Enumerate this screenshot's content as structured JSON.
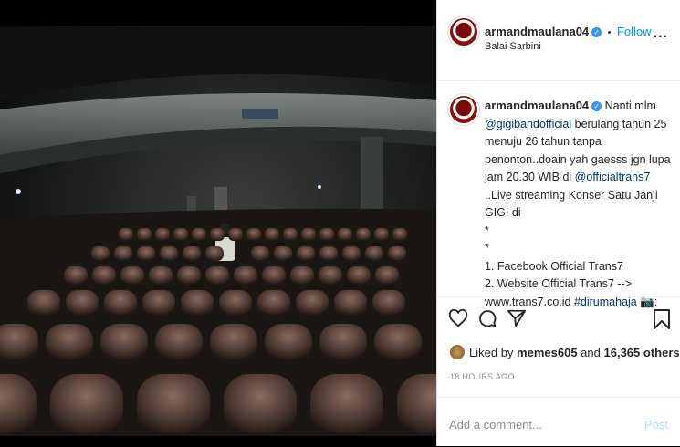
{
  "post": {
    "username": "armandmaulana04",
    "follow_label": "Follow",
    "separator": "•",
    "location": "Balai Sarbini",
    "more_label": "...",
    "caption": {
      "username": "armandmaulana04",
      "text_1": "Nanti mlm",
      "mention_1": "@gigibandofficial",
      "text_2": "berulang tahun 25 menuju 26 tahun tanpa penonton..doain yah gaesss jgn lupa jam 20.30 WIB di",
      "mention_2": "@officialtrans7",
      "text_3": "..Live streaming Konser Satu Janji GIGI di",
      "bullet_1": "*",
      "bullet_2": "*",
      "line_1": "1. Facebook Official Trans7",
      "line_2": "2. Website Official Trans7 -->",
      "url": "www.trans7.co.id",
      "hashtag": "#dirumahaja",
      "tail": ":"
    },
    "likes": {
      "prefix": "Liked by",
      "user": "memes605",
      "middle": "and",
      "count": "16,365 others"
    },
    "timestamp": "18 HOURS AGO",
    "comment_placeholder": "Add a comment...",
    "post_label": "Post",
    "icons": [
      "heart-icon",
      "comment-icon",
      "share-icon",
      "bookmark-icon",
      "camera-emoji-icon"
    ]
  }
}
